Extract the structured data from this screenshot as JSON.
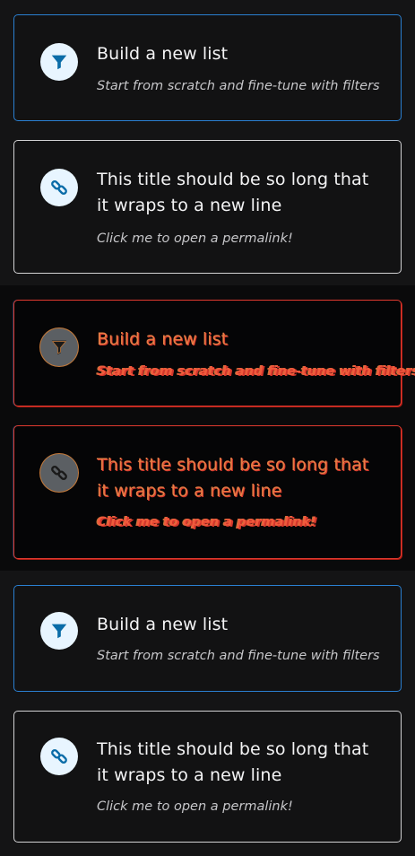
{
  "colors": {
    "accent": "#2a7fd0",
    "icon_fill": "#0a6ca8",
    "icon_bg": "#e8f5ff",
    "glitch_red": "#e03a2f",
    "glitch_orange": "#e67d45"
  },
  "cards": {
    "build": {
      "icon": "filter-icon",
      "title": "Build a new list",
      "subtitle": "Start from scratch and fine-tune with filters"
    },
    "permalink": {
      "icon": "link-icon",
      "title": "This title should be so long that it wraps to a new line",
      "subtitle": "Click me to open a permalink!"
    }
  }
}
